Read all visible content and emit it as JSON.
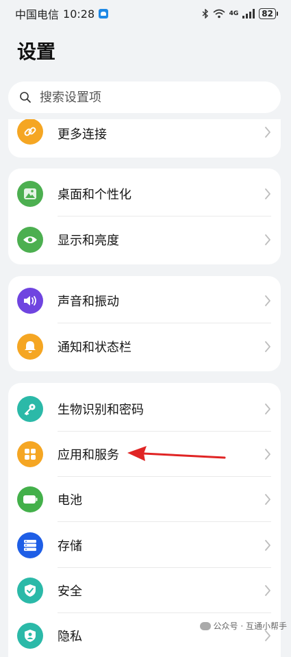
{
  "status_bar": {
    "carrier": "中国电信",
    "time": "10:28",
    "network": "4G",
    "battery": "82"
  },
  "page_title": "设置",
  "search": {
    "placeholder": "搜索设置项"
  },
  "cards": [
    {
      "items": [
        {
          "label": "更多连接",
          "icon": "link-icon",
          "color": "#f5a623"
        }
      ]
    },
    {
      "items": [
        {
          "label": "桌面和个性化",
          "icon": "image-icon",
          "color": "#4caf50"
        },
        {
          "label": "显示和亮度",
          "icon": "eye-icon",
          "color": "#4caf50"
        }
      ]
    },
    {
      "items": [
        {
          "label": "声音和振动",
          "icon": "speaker-icon",
          "color": "#6f44e0"
        },
        {
          "label": "通知和状态栏",
          "icon": "bell-icon",
          "color": "#f5a623"
        }
      ]
    },
    {
      "items": [
        {
          "label": "生物识别和密码",
          "icon": "key-icon",
          "color": "#2bb9a8"
        },
        {
          "label": "应用和服务",
          "icon": "apps-icon",
          "color": "#f5a623"
        },
        {
          "label": "电池",
          "icon": "battery-icon",
          "color": "#43b04a"
        },
        {
          "label": "存储",
          "icon": "storage-icon",
          "color": "#1e5ee6"
        },
        {
          "label": "安全",
          "icon": "shield-check-icon",
          "color": "#2bb9a8"
        },
        {
          "label": "隐私",
          "icon": "privacy-icon",
          "color": "#2bb9a8"
        }
      ]
    }
  ],
  "annotation": {
    "arrow_color": "#e02424"
  },
  "watermark": {
    "text": "公众号 · 互通小帮手"
  }
}
